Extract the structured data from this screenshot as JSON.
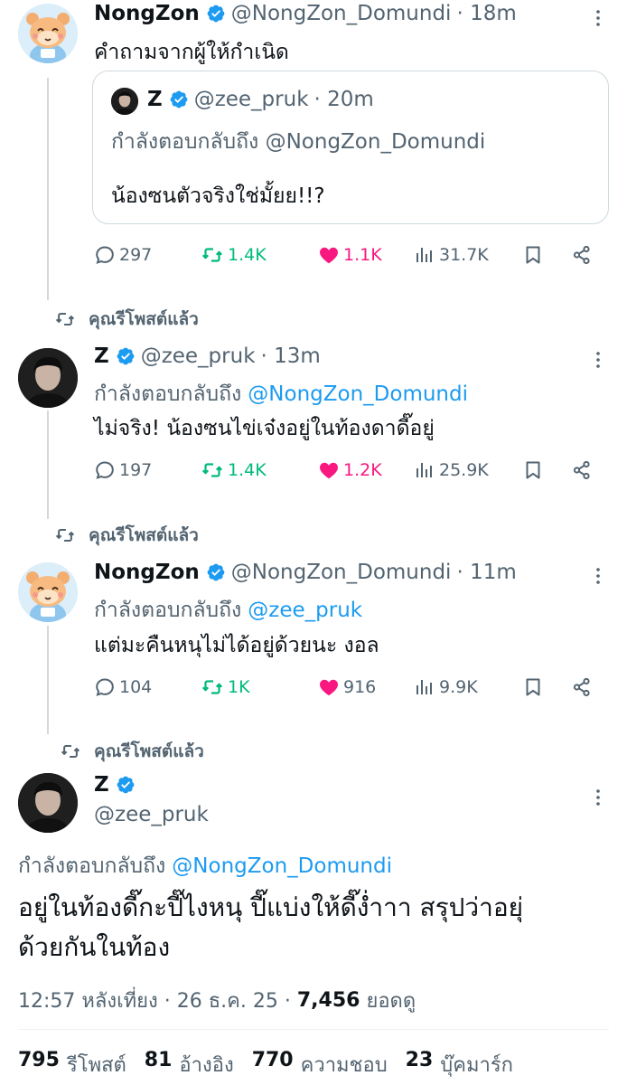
{
  "tweet1": {
    "name": "NongZon",
    "handle": "@NongZon_Domundi",
    "time": "· 18m",
    "text": "คำถามจากผู้ให้กำเนิด",
    "quote": {
      "name": "Z",
      "handle": "@zee_pruk",
      "time": "· 20m",
      "reply_to": "กำลังตอบกลับถึง @NongZon_Domundi",
      "text": "น้องซนตัวจริงใช่มั้ยย!!?"
    },
    "replies": "297",
    "reposts": "1.4K",
    "likes": "1.1K",
    "views": "31.7K"
  },
  "repost_label_1": "คุณรีโพสต์แล้ว",
  "tweet2": {
    "name": "Z",
    "handle": "@zee_pruk",
    "time": "· 13m",
    "reply_prefix": "กำลังตอบกลับถึง",
    "reply_handle": "@NongZon_Domundi",
    "text": "ไม่จริง! น้องซนไข่เจ๋งอยู่ในท้องดาดี๊อยู่",
    "replies": "197",
    "reposts": "1.4K",
    "likes": "1.2K",
    "views": "25.9K"
  },
  "repost_label_2": "คุณรีโพสต์แล้ว",
  "tweet3": {
    "name": "NongZon",
    "handle": "@NongZon_Domundi",
    "time": "· 11m",
    "reply_prefix": "กำลังตอบกลับถึง",
    "reply_handle": "@zee_pruk",
    "text": "แต่มะคืนหนุไม่ได้อยู่ด้วยนะ งอล",
    "replies": "104",
    "reposts": "1K",
    "likes": "916",
    "views": "9.9K"
  },
  "repost_label_3": "คุณรีโพสต์แล้ว",
  "main_tweet": {
    "name": "Z",
    "handle": "@zee_pruk",
    "reply_prefix": "กำลังตอบกลับถึง",
    "reply_handle": "@NongZon_Domundi",
    "text_line1": "อยู่ในท้องดี๊กะปี๊ไงหนุ ปี๊แบ่งให้ดี๊ง่ำาา สรุปว่าอยุ่",
    "text_line2": "ด้วยกันในท้อง",
    "meta_time": "12:57 หลังเที่ยง · 26 ธ.ค. 25 ·",
    "meta_views_num": "7,456",
    "meta_views_label": "ยอดดู",
    "stats": {
      "reposts_num": "795",
      "reposts_label": "รีโพสต์",
      "quotes_num": "81",
      "quotes_label": "อ้างอิง",
      "likes_num": "770",
      "likes_label": "ความชอบ",
      "bookmarks_num": "23",
      "bookmarks_label": "บุ๊คมาร์ก"
    }
  },
  "colors": {
    "accent": "#1d9bf0",
    "repost": "#00ba7c",
    "like": "#f91880",
    "muted": "#536471"
  }
}
